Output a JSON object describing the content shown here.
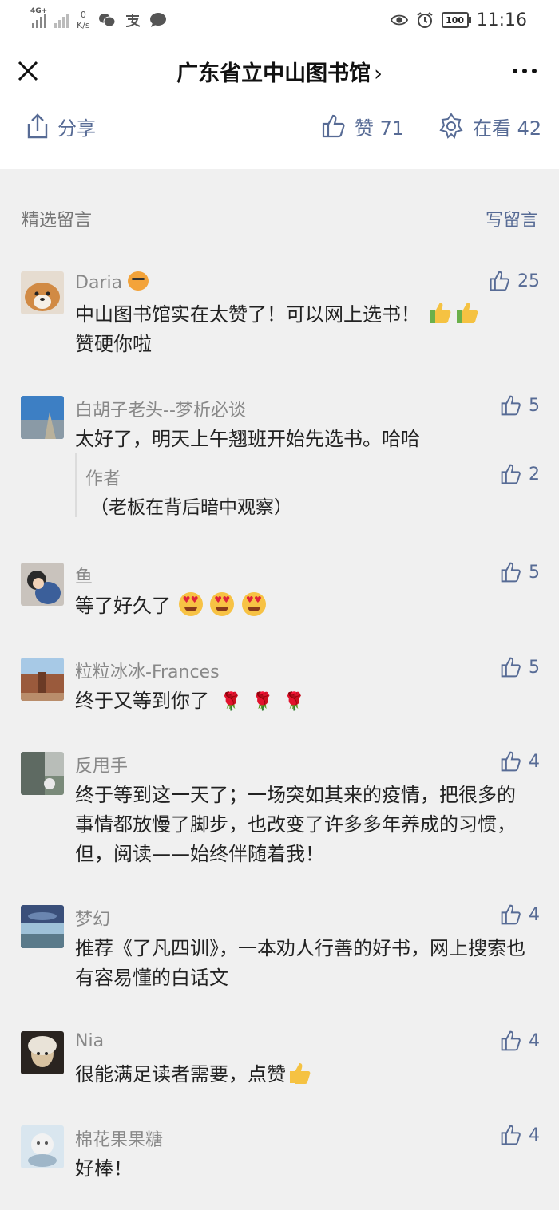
{
  "status_bar": {
    "network_label": "4G+",
    "speed_value": "0",
    "speed_unit": "K/s",
    "battery": "100",
    "time": "11:16",
    "icons": [
      "wechat-icon",
      "alipay-icon",
      "message-icon",
      "eye-icon",
      "alarm-icon"
    ]
  },
  "nav": {
    "title": "广东省立中山图书馆",
    "chevron": "›"
  },
  "actions": {
    "share_label": "分享",
    "like_label": "赞 71",
    "watching_label": "在看 42"
  },
  "comments_section": {
    "title": "精选留言",
    "write_label": "写留言",
    "accent_color": "#576b95"
  },
  "comments": [
    {
      "name": "Daria",
      "text": "中山图书馆实在太赞了！可以网上选书！",
      "text2": "赞硬你啦",
      "likes": "25"
    },
    {
      "name": "白胡子老头--梦析必谈",
      "text": "太好了，明天上午翘班开始先选书。哈哈",
      "likes": "5",
      "reply": {
        "name": "作者",
        "text": "（老板在背后暗中观察）",
        "likes": "2"
      }
    },
    {
      "name": "鱼",
      "text": "等了好久了",
      "likes": "5"
    },
    {
      "name": "粒粒冰冰-Frances",
      "text": "终于又等到你了",
      "likes": "5"
    },
    {
      "name": "反甩手",
      "text": "终于等到这一天了；一场突如其来的疫情，把很多的事情都放慢了脚步，也改变了许多多年养成的习惯，但，阅读——始终伴随着我！",
      "likes": "4"
    },
    {
      "name": "梦幻",
      "text": "推荐《了凡四训》，一本劝人行善的好书，网上搜索也有容易懂的白话文",
      "likes": "4"
    },
    {
      "name": "Nia",
      "text": "很能满足读者需要，点赞",
      "likes": "4"
    },
    {
      "name": "棉花果果糖",
      "text": "好棒！",
      "likes": "4"
    }
  ]
}
